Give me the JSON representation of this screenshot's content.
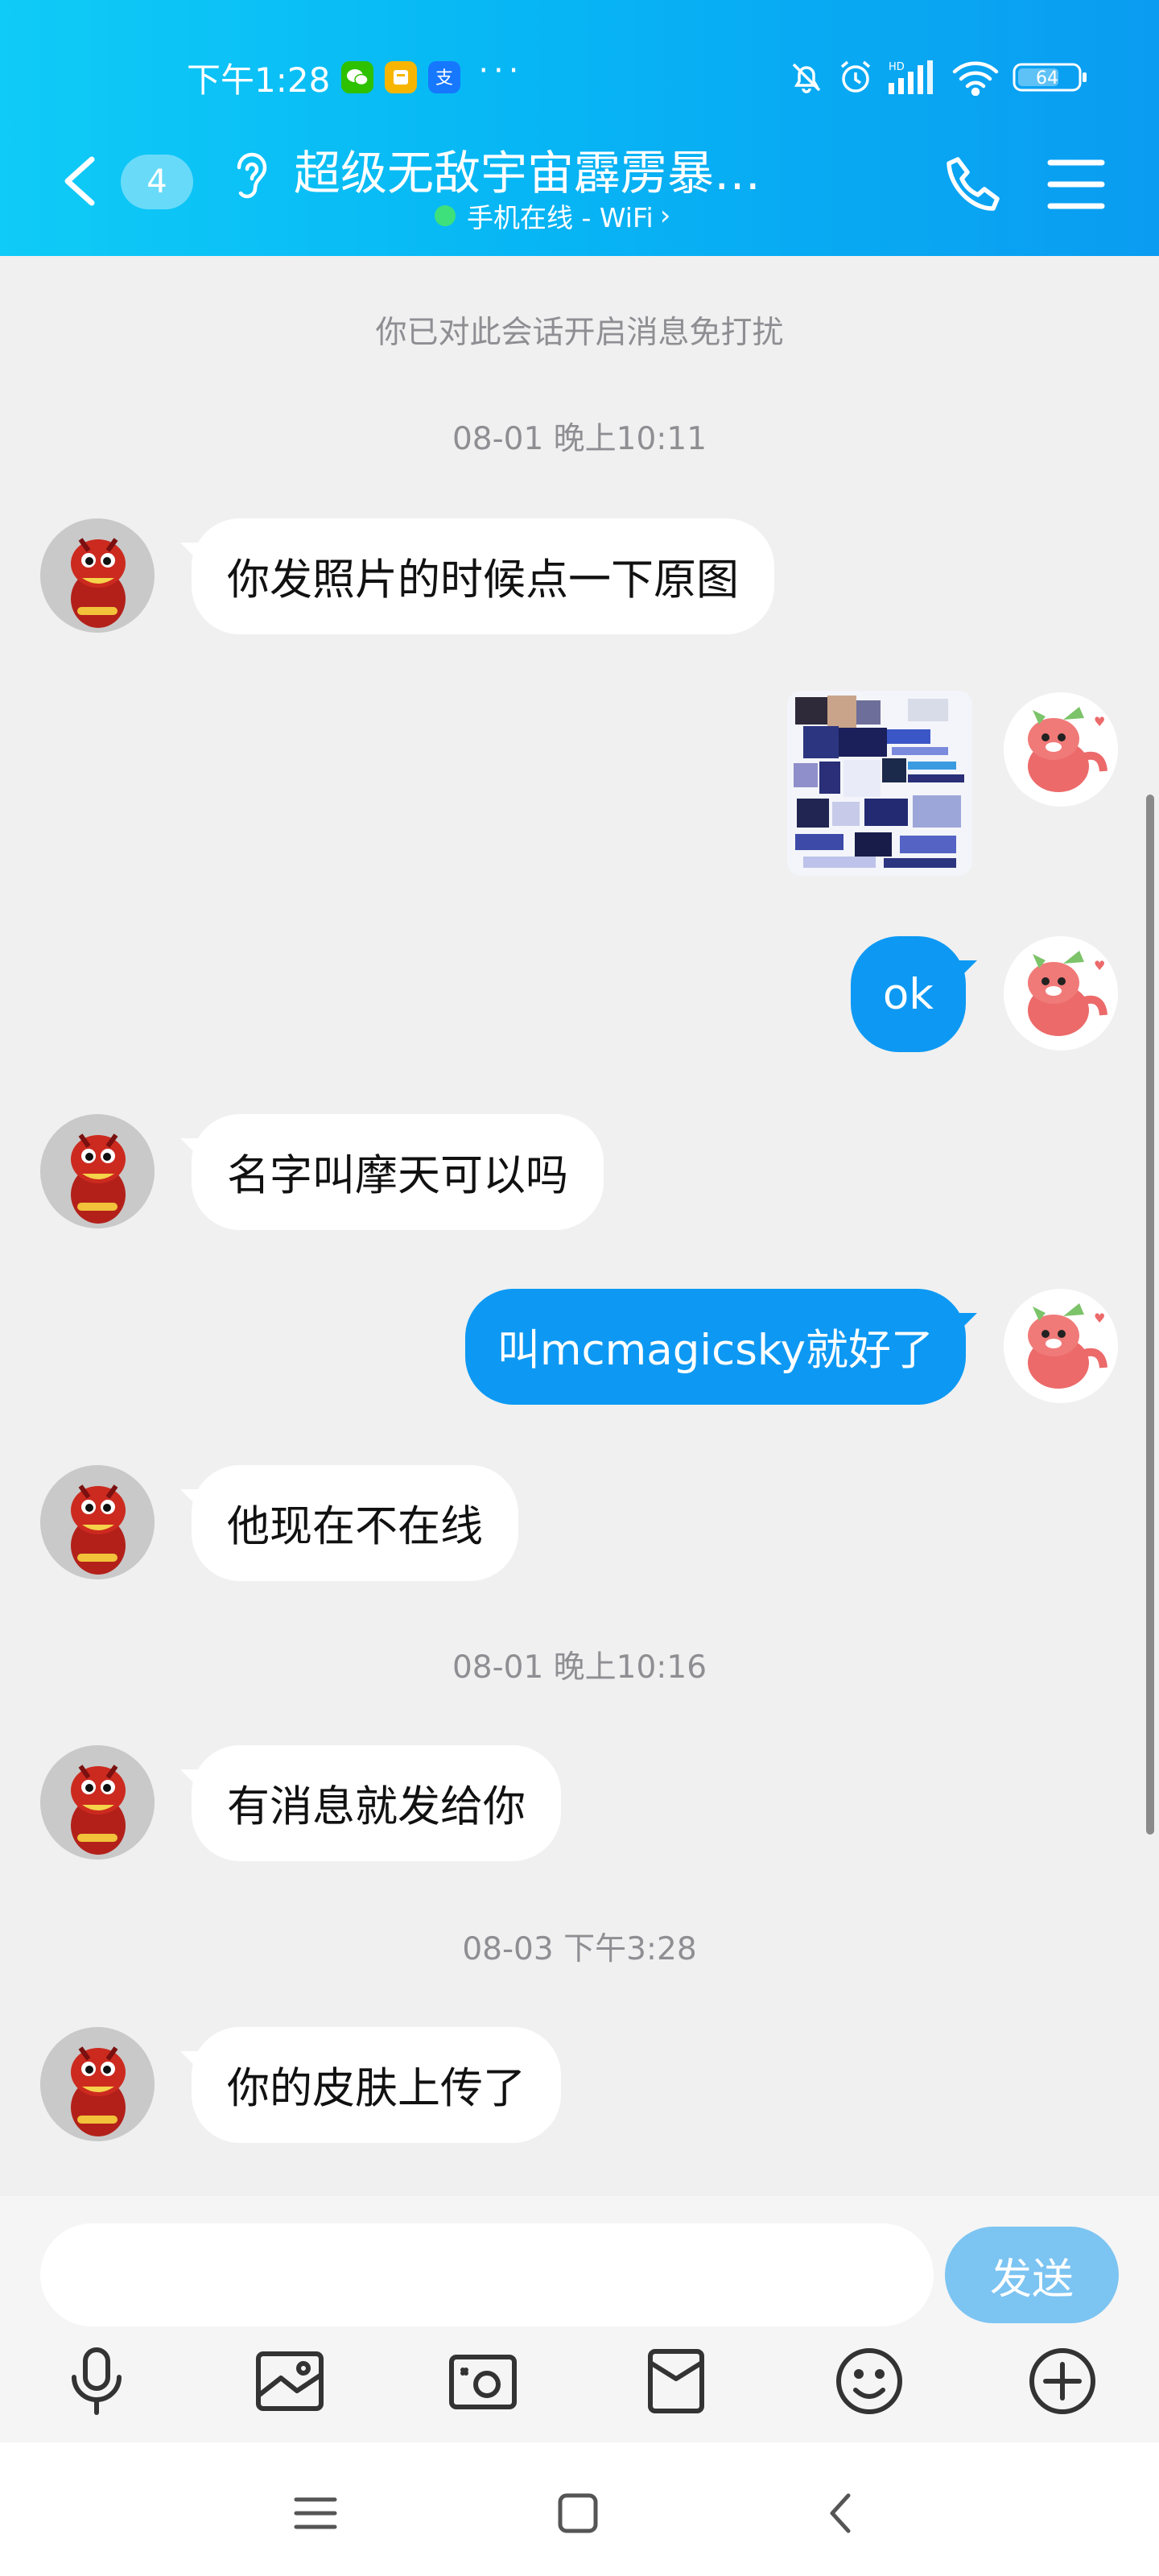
{
  "status_bar": {
    "time": "下午1:28",
    "battery": "64",
    "network_label": "HD"
  },
  "header": {
    "unread_count": "4",
    "title": "超级无敌宇宙霹雳暴…",
    "status": "手机在线 - WiFi",
    "status_chevron": "›"
  },
  "chat": {
    "mute_notice": "你已对此会话开启消息免打扰",
    "messages": [
      {
        "type": "timestamp",
        "text": "08-01 晚上10:11"
      },
      {
        "type": "text",
        "side": "left",
        "text": "你发照片的时候点一下原图"
      },
      {
        "type": "image",
        "side": "right"
      },
      {
        "type": "text",
        "side": "right",
        "text": "ok"
      },
      {
        "type": "text",
        "side": "left",
        "text": "名字叫摩天可以吗"
      },
      {
        "type": "text",
        "side": "right",
        "text": "叫mcmagicsky就好了"
      },
      {
        "type": "text",
        "side": "left",
        "text": "他现在不在线"
      },
      {
        "type": "timestamp",
        "text": "08-01 晚上10:16"
      },
      {
        "type": "text",
        "side": "left",
        "text": "有消息就发给你"
      },
      {
        "type": "timestamp",
        "text": "08-03 下午3:28"
      },
      {
        "type": "text",
        "side": "left",
        "text": "你的皮肤上传了"
      }
    ]
  },
  "input": {
    "placeholder": "",
    "send_label": "发送"
  },
  "colors": {
    "header_gradient_start": "#0fcbf7",
    "header_gradient_end": "#0a9cf1",
    "sent_bubble": "#0d99f3",
    "send_button": "#7cc4f2"
  }
}
